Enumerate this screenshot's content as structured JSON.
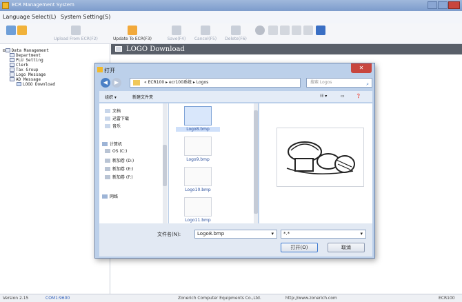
{
  "window": {
    "title": "ECR Management System"
  },
  "menu": [
    "Language Select(L)",
    "System Setting(S)"
  ],
  "toolbar": {
    "upload_label": "Upload From ECR(F2)",
    "update_label": "Update To ECR(F3)",
    "save_label": "Save(F4)",
    "cancel_label": "Cancel(F5)",
    "delete_label": "Delete(F6)"
  },
  "tree": {
    "root": "Data Management",
    "items": [
      "Department",
      "PLU Setting",
      "Clerk",
      "Tax Group",
      "Logo Message",
      "AD Message",
      "LOGO Download"
    ]
  },
  "content": {
    "header": "LOGO Download"
  },
  "dialog": {
    "title": "打开",
    "close": "✕",
    "breadcrumb": "« ECR100 ▸ ecr100系统 ▸ Logos",
    "search_placeholder": "搜索 Logos",
    "organize": "组织 ▾",
    "new_folder": "新建文件夹",
    "nav": [
      "文档",
      "迅雷下载",
      "音乐",
      "计算机",
      "OS (C:)",
      "新加卷 (D:)",
      "新加卷 (E:)",
      "新加卷 (F:)",
      "网络"
    ],
    "files": [
      "Logo8.bmp",
      "Logo9.bmp",
      "Logo10.bmp",
      "Logo11.bmp"
    ],
    "filename_label": "文件名(N):",
    "filename_value": "Logo8.bmp",
    "filetype_value": "*.*",
    "open_button": "打开(O)",
    "cancel_button": "取消"
  },
  "status": {
    "version": "Version 2.15",
    "port": "COM1:9600",
    "company": "Zonerich Computer Equipments Co.,Ltd.",
    "url": "http://www.zonerich.com",
    "device": "ECR100"
  },
  "colors": {
    "titlebar": "#8aa6d3",
    "content_header": "#595f69",
    "dialog_frame": "#bcd0ea",
    "close_button": "#c8463e"
  }
}
